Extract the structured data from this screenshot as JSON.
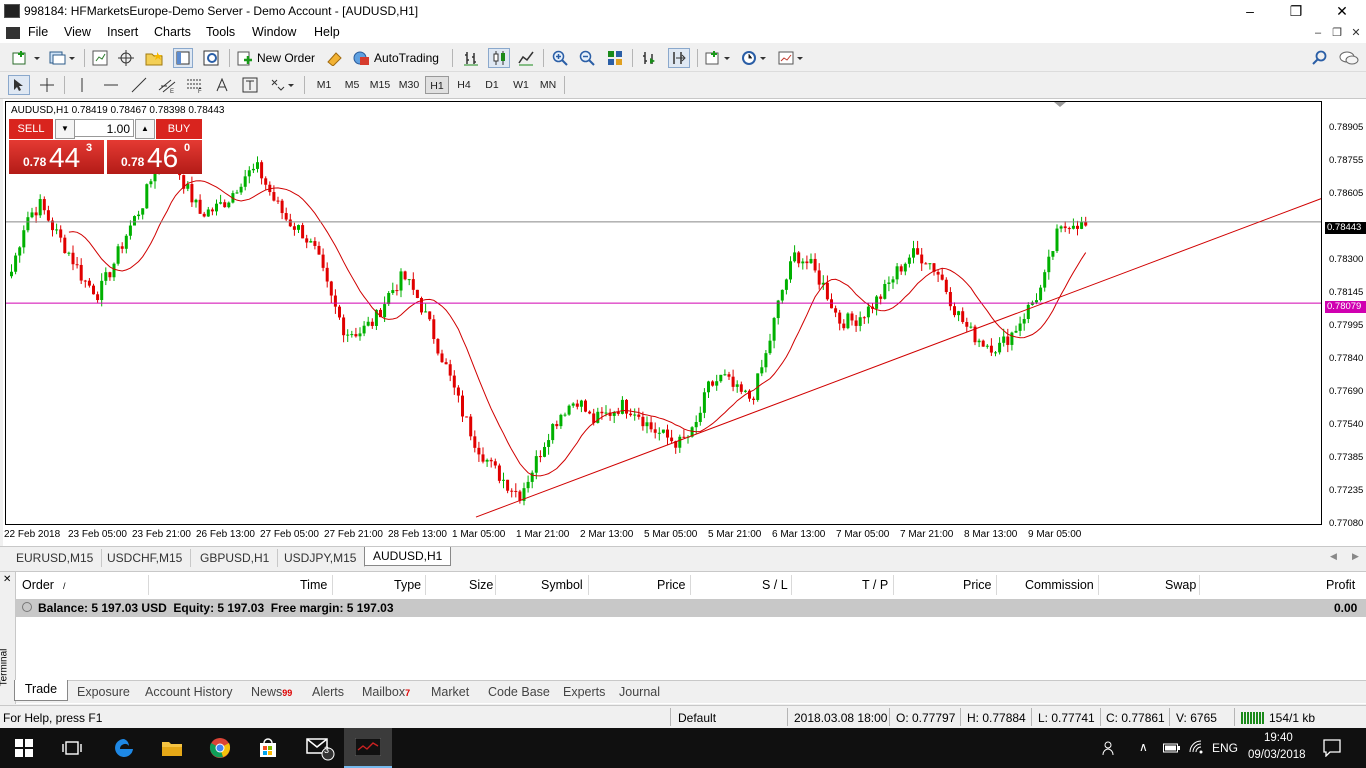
{
  "window": {
    "title": "998184: HFMarketsEurope-Demo Server - Demo Account - [AUDUSD,H1]"
  },
  "menu": [
    "File",
    "View",
    "Insert",
    "Charts",
    "Tools",
    "Window",
    "Help"
  ],
  "toolbar": {
    "new_order": "New Order",
    "autotrading": "AutoTrading"
  },
  "timeframes": [
    "M1",
    "M5",
    "M15",
    "M30",
    "H1",
    "H4",
    "D1",
    "W1",
    "MN"
  ],
  "active_timeframe": "H1",
  "chart": {
    "header": "AUDUSD,H1  0.78419 0.78467 0.78398 0.78443",
    "sell_label": "SELL",
    "buy_label": "BUY",
    "lot": "1.00",
    "sell_small": "0.78",
    "sell_big": "44",
    "sell_sup": "3",
    "buy_small": "0.78",
    "buy_big": "46",
    "buy_sup": "0",
    "y_labels": [
      "0.78905",
      "0.78755",
      "0.78605",
      "0.78443",
      "0.78300",
      "0.78145",
      "0.78079",
      "0.77995",
      "0.77840",
      "0.77690",
      "0.77540",
      "0.77385",
      "0.77235",
      "0.77080"
    ],
    "current_price_tag": "0.78443",
    "hline_price_tag": "0.78079",
    "x_labels": [
      "22 Feb 2018",
      "23 Feb 05:00",
      "23 Feb 21:00",
      "26 Feb 13:00",
      "27 Feb 05:00",
      "27 Feb 21:00",
      "28 Feb 13:00",
      "1 Mar 05:00",
      "1 Mar 21:00",
      "2 Mar 13:00",
      "5 Mar 05:00",
      "5 Mar 21:00",
      "6 Mar 13:00",
      "7 Mar 05:00",
      "7 Mar 21:00",
      "8 Mar 13:00",
      "9 Mar 05:00"
    ],
    "colors": {
      "bull": "#00b000",
      "bear": "#e00000",
      "ma": "#d00000",
      "trendline": "#d00000",
      "hline": "#d000b0",
      "bidline": "#888888"
    }
  },
  "chart_data": {
    "type": "candlestick",
    "symbol": "AUDUSD,H1",
    "ylim": [
      0.7708,
      0.7898
    ],
    "current_price": 0.78443,
    "horizontal_line": 0.78079,
    "trendline": {
      "from_x": "1 Mar 05:00",
      "from_y": 0.7712,
      "to_x": "9 Mar 19:00",
      "to_y": 0.7815
    },
    "close_path": [
      0.7822,
      0.7846,
      0.7852,
      0.784,
      0.783,
      0.7818,
      0.7812,
      0.7825,
      0.784,
      0.7852,
      0.787,
      0.7875,
      0.786,
      0.7848,
      0.785,
      0.7855,
      0.7865,
      0.7868,
      0.7855,
      0.7845,
      0.784,
      0.783,
      0.781,
      0.7795,
      0.7795,
      0.78,
      0.7812,
      0.782,
      0.781,
      0.7795,
      0.7778,
      0.776,
      0.7745,
      0.7735,
      0.7728,
      0.7722,
      0.7735,
      0.775,
      0.776,
      0.7765,
      0.7755,
      0.7758,
      0.7762,
      0.776,
      0.7752,
      0.7748,
      0.7745,
      0.775,
      0.777,
      0.7775,
      0.7768,
      0.7765,
      0.7785,
      0.7812,
      0.783,
      0.7825,
      0.7815,
      0.78,
      0.78,
      0.7805,
      0.7812,
      0.7822,
      0.783,
      0.7828,
      0.782,
      0.7805,
      0.7795,
      0.779,
      0.7788,
      0.7795,
      0.7805,
      0.7815,
      0.7838,
      0.7845,
      0.7842
    ]
  },
  "chart_tabs": [
    "EURUSD,M15",
    "USDCHF,M15",
    "GBPUSD,H1",
    "USDJPY,M15",
    "AUDUSD,H1"
  ],
  "active_chart_tab": "AUDUSD,H1",
  "terminal": {
    "side_label": "Terminal",
    "columns": [
      "Order",
      "/",
      "Time",
      "Type",
      "Size",
      "Symbol",
      "Price",
      "S / L",
      "T / P",
      "Price",
      "Commission",
      "Swap",
      "Profit"
    ],
    "balance_text": "Balance: 5 197.03 USD  Equity: 5 197.03  Free margin: 5 197.03",
    "profit": "0.00",
    "tabs": [
      {
        "label": "Trade",
        "badge": ""
      },
      {
        "label": "Exposure",
        "badge": ""
      },
      {
        "label": "Account History",
        "badge": ""
      },
      {
        "label": "News",
        "badge": "99"
      },
      {
        "label": "Alerts",
        "badge": ""
      },
      {
        "label": "Mailbox",
        "badge": "7"
      },
      {
        "label": "Market",
        "badge": ""
      },
      {
        "label": "Code Base",
        "badge": ""
      },
      {
        "label": "Experts",
        "badge": ""
      },
      {
        "label": "Journal",
        "badge": ""
      }
    ]
  },
  "status": {
    "help": "For Help, press F1",
    "profile": "Default",
    "datetime": "2018.03.08 18:00",
    "open": "O: 0.77797",
    "high": "H: 0.77884",
    "low": "L: 0.77741",
    "close": "C: 0.77861",
    "volume": "V: 6765",
    "traffic": "154/1 kb"
  },
  "taskbar": {
    "badge": "3",
    "lang": "ENG",
    "time": "19:40",
    "date": "09/03/2018"
  }
}
